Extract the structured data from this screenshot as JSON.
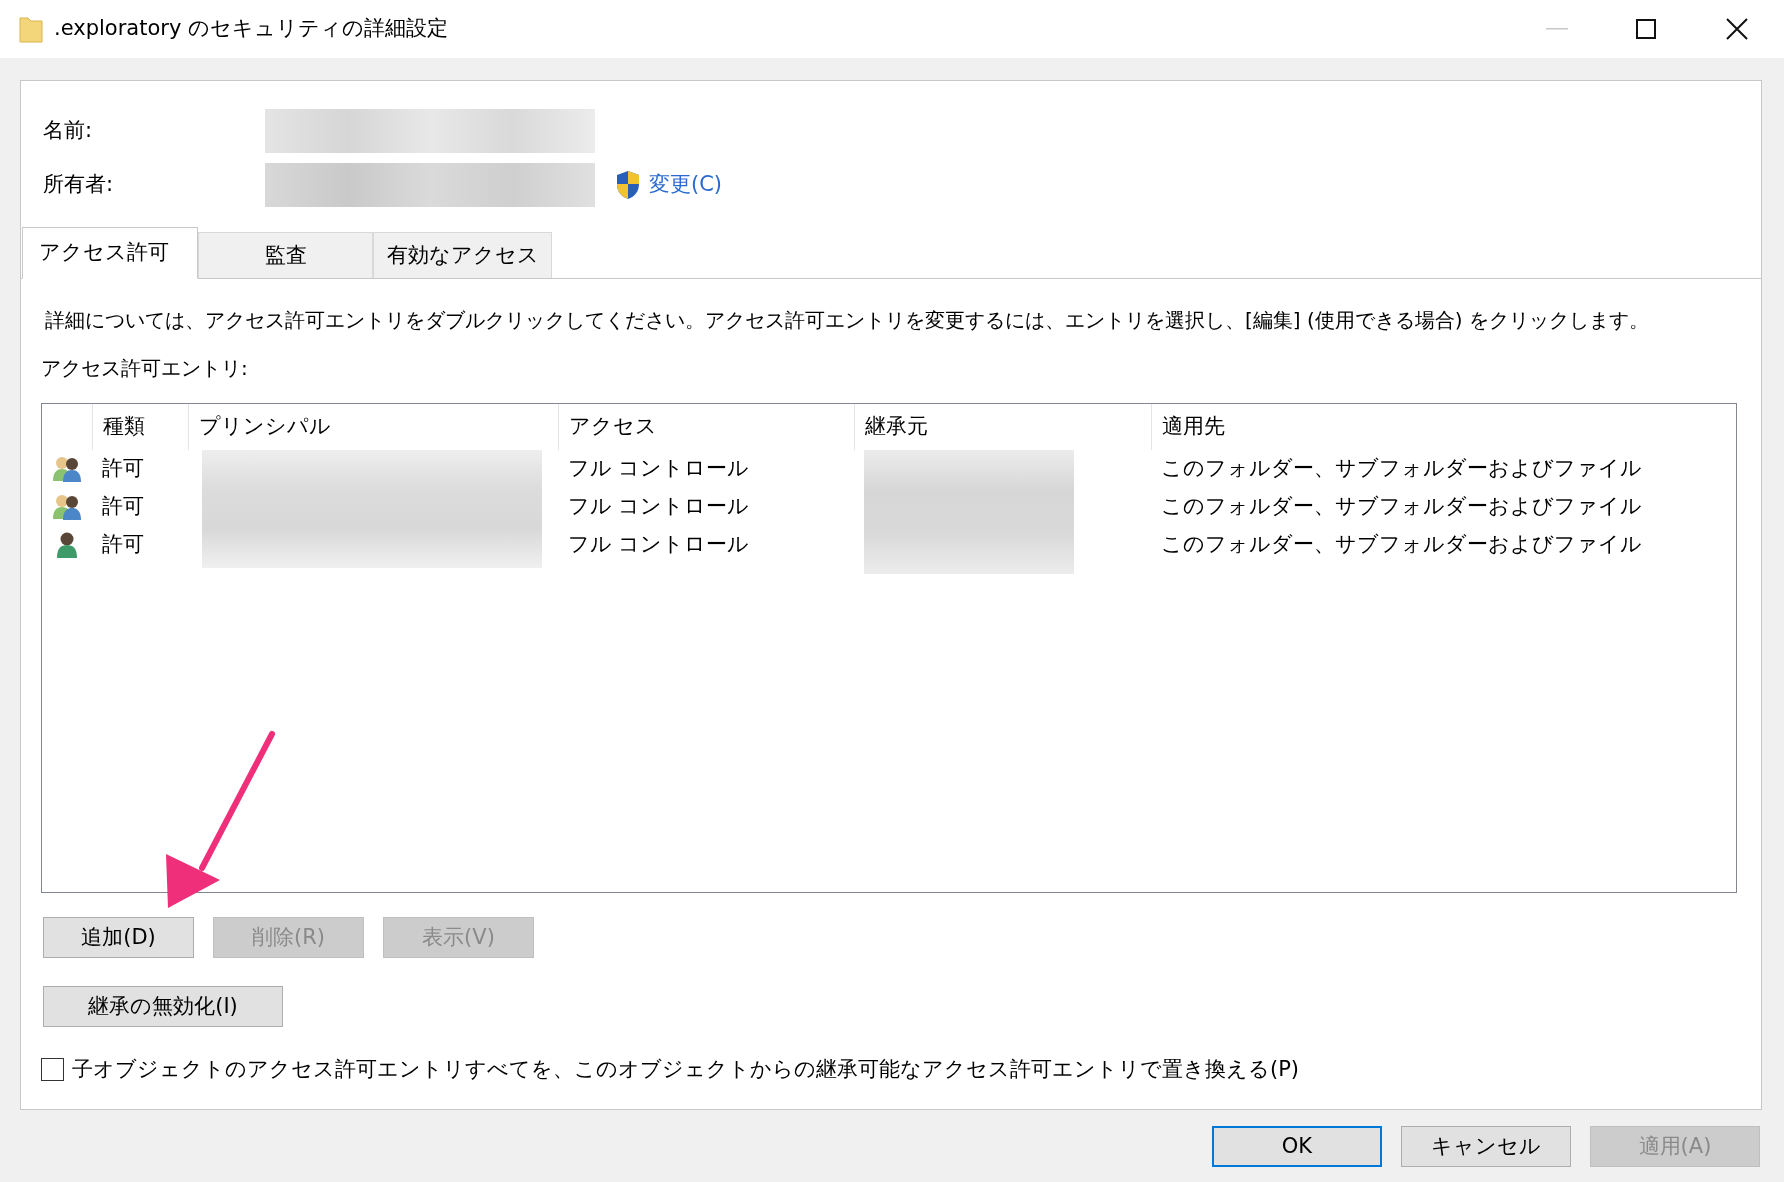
{
  "window": {
    "title": ".exploratory のセキュリティの詳細設定"
  },
  "fields": [
    {
      "label": "名前:"
    },
    {
      "label": "所有者:",
      "link": "変更(C)"
    }
  ],
  "tabs": [
    {
      "label": "アクセス許可",
      "selected": true
    },
    {
      "label": "監査",
      "selected": false
    },
    {
      "label": "有効なアクセス",
      "selected": false
    }
  ],
  "description": "詳細については、アクセス許可エントリをダブルクリックしてください。アクセス許可エントリを変更するには、エントリを選択し、[編集] (使用できる場合) をクリックします。",
  "list_label": "アクセス許可エントリ:",
  "table": {
    "columns": [
      "種類",
      "プリンシパル",
      "アクセス",
      "継承元",
      "適用先"
    ],
    "rows": [
      {
        "kind": "group",
        "type": "許可",
        "access": "フル コントロール",
        "applies_to": "このフォルダー、サブフォルダーおよびファイル"
      },
      {
        "kind": "group",
        "type": "許可",
        "access": "フル コントロール",
        "applies_to": "このフォルダー、サブフォルダーおよびファイル"
      },
      {
        "kind": "user",
        "type": "許可",
        "access": "フル コントロール",
        "applies_to": "このフォルダー、サブフォルダーおよびファイル"
      }
    ]
  },
  "entry_buttons": [
    {
      "label": "追加(D)",
      "disabled": false
    },
    {
      "label": "削除(R)",
      "disabled": true
    },
    {
      "label": "表示(V)",
      "disabled": true
    }
  ],
  "inherit_button": {
    "label": "継承の無効化(I)"
  },
  "replace_checkbox": {
    "label": "子オブジェクトのアクセス許可エントリすべてを、このオブジェクトからの継承可能なアクセス許可エントリで置き換える(P)",
    "checked": false
  },
  "dialog_buttons": [
    {
      "label": "OK",
      "disabled": false,
      "default": true
    },
    {
      "label": "キャンセル",
      "disabled": false,
      "default": false
    },
    {
      "label": "適用(A)",
      "disabled": true,
      "default": false
    }
  ]
}
